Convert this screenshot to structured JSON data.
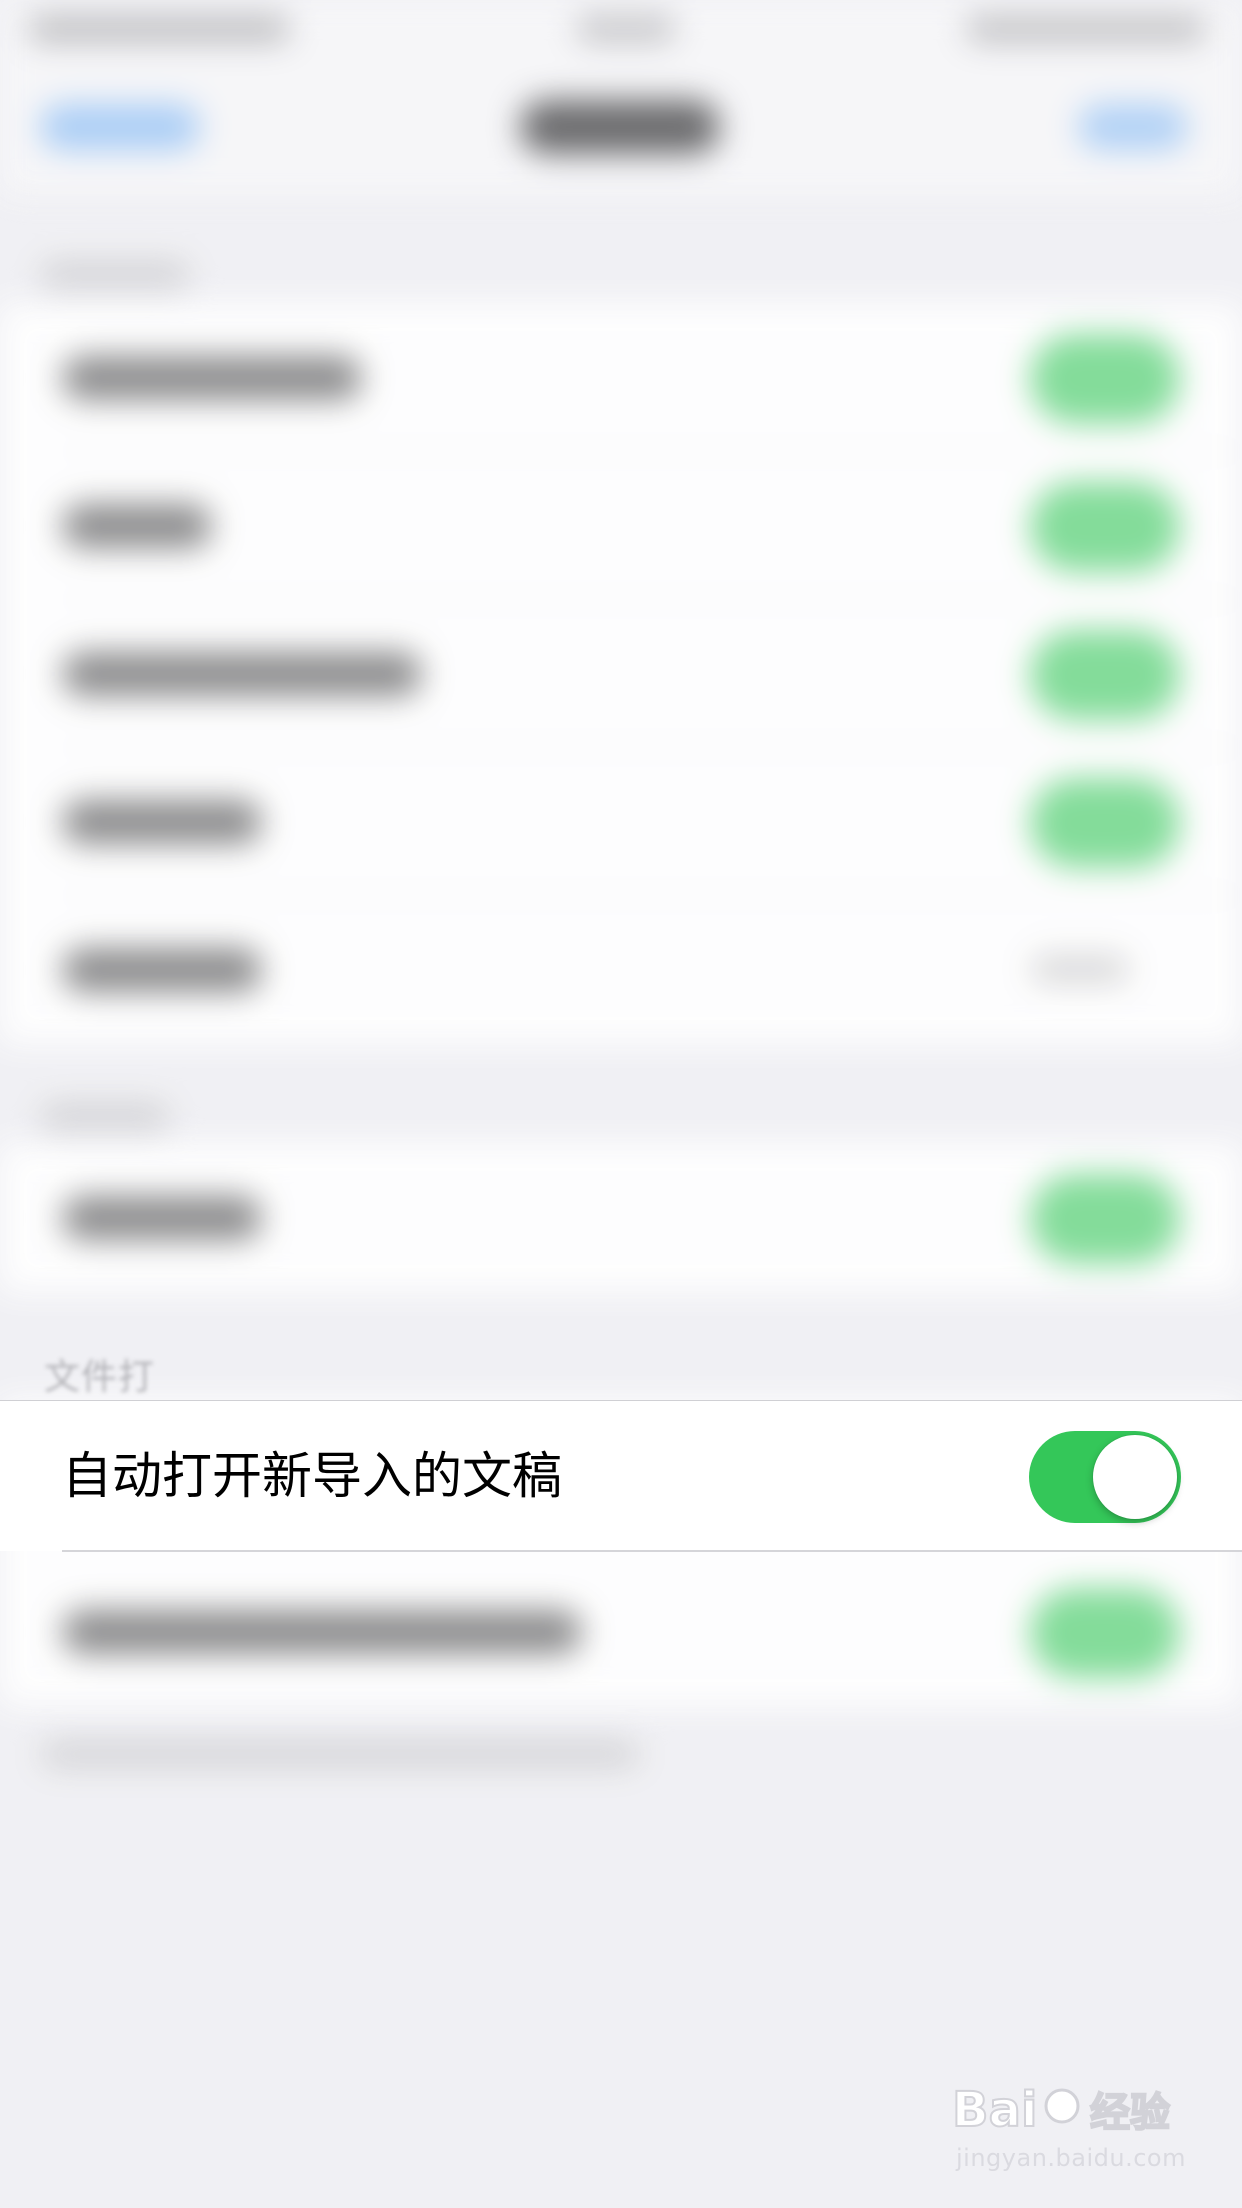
{
  "section_header": "文件打",
  "focused_setting": {
    "label": "自动打开新导入的文稿",
    "toggle_on": true
  },
  "colors": {
    "toggle_on": "#34c759",
    "accent_blue": "#62a8f6",
    "background": "#f0f0f4"
  },
  "watermark": {
    "logo_text": "Baidu经验",
    "url": "jingyan.baidu.com"
  }
}
